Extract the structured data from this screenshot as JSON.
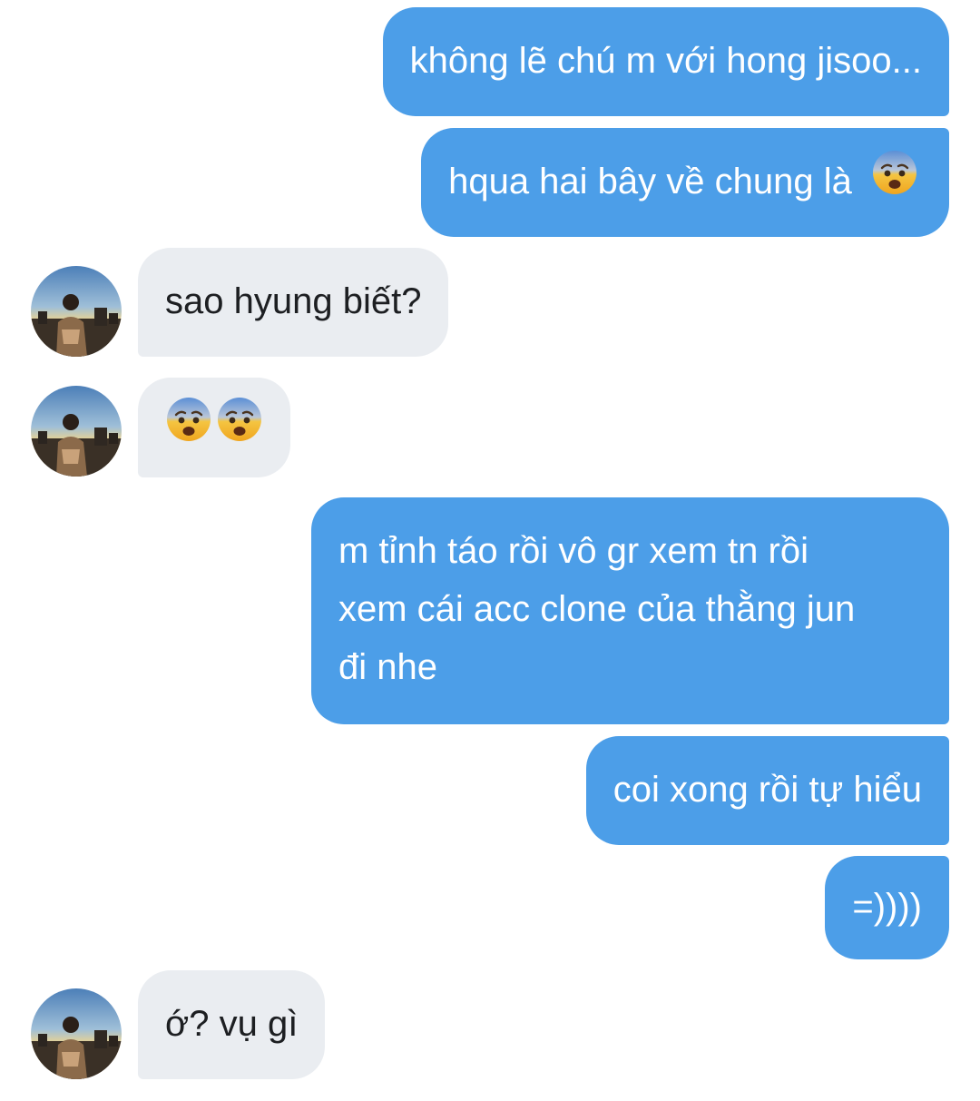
{
  "messages": {
    "m1": "không lẽ chú m với hong jisoo...",
    "m2": "hqua hai bây về chung là",
    "m3": "sao hyung biết?",
    "m5_l1": "m tỉnh táo rồi vô gr xem tn rồi",
    "m5_l2": "xem cái acc clone của thằng jun",
    "m5_l3": "đi nhe",
    "m6": "coi xong rồi tự hiểu",
    "m7": "=))))",
    "m8": "ớ? vụ gì"
  },
  "emoji": {
    "name": "anxious-face-icon"
  },
  "colors": {
    "outgoing_bubble": "#4c9ee8",
    "incoming_bubble": "#eaedf1",
    "outgoing_text": "#ffffff",
    "incoming_text": "#1d1f22"
  }
}
